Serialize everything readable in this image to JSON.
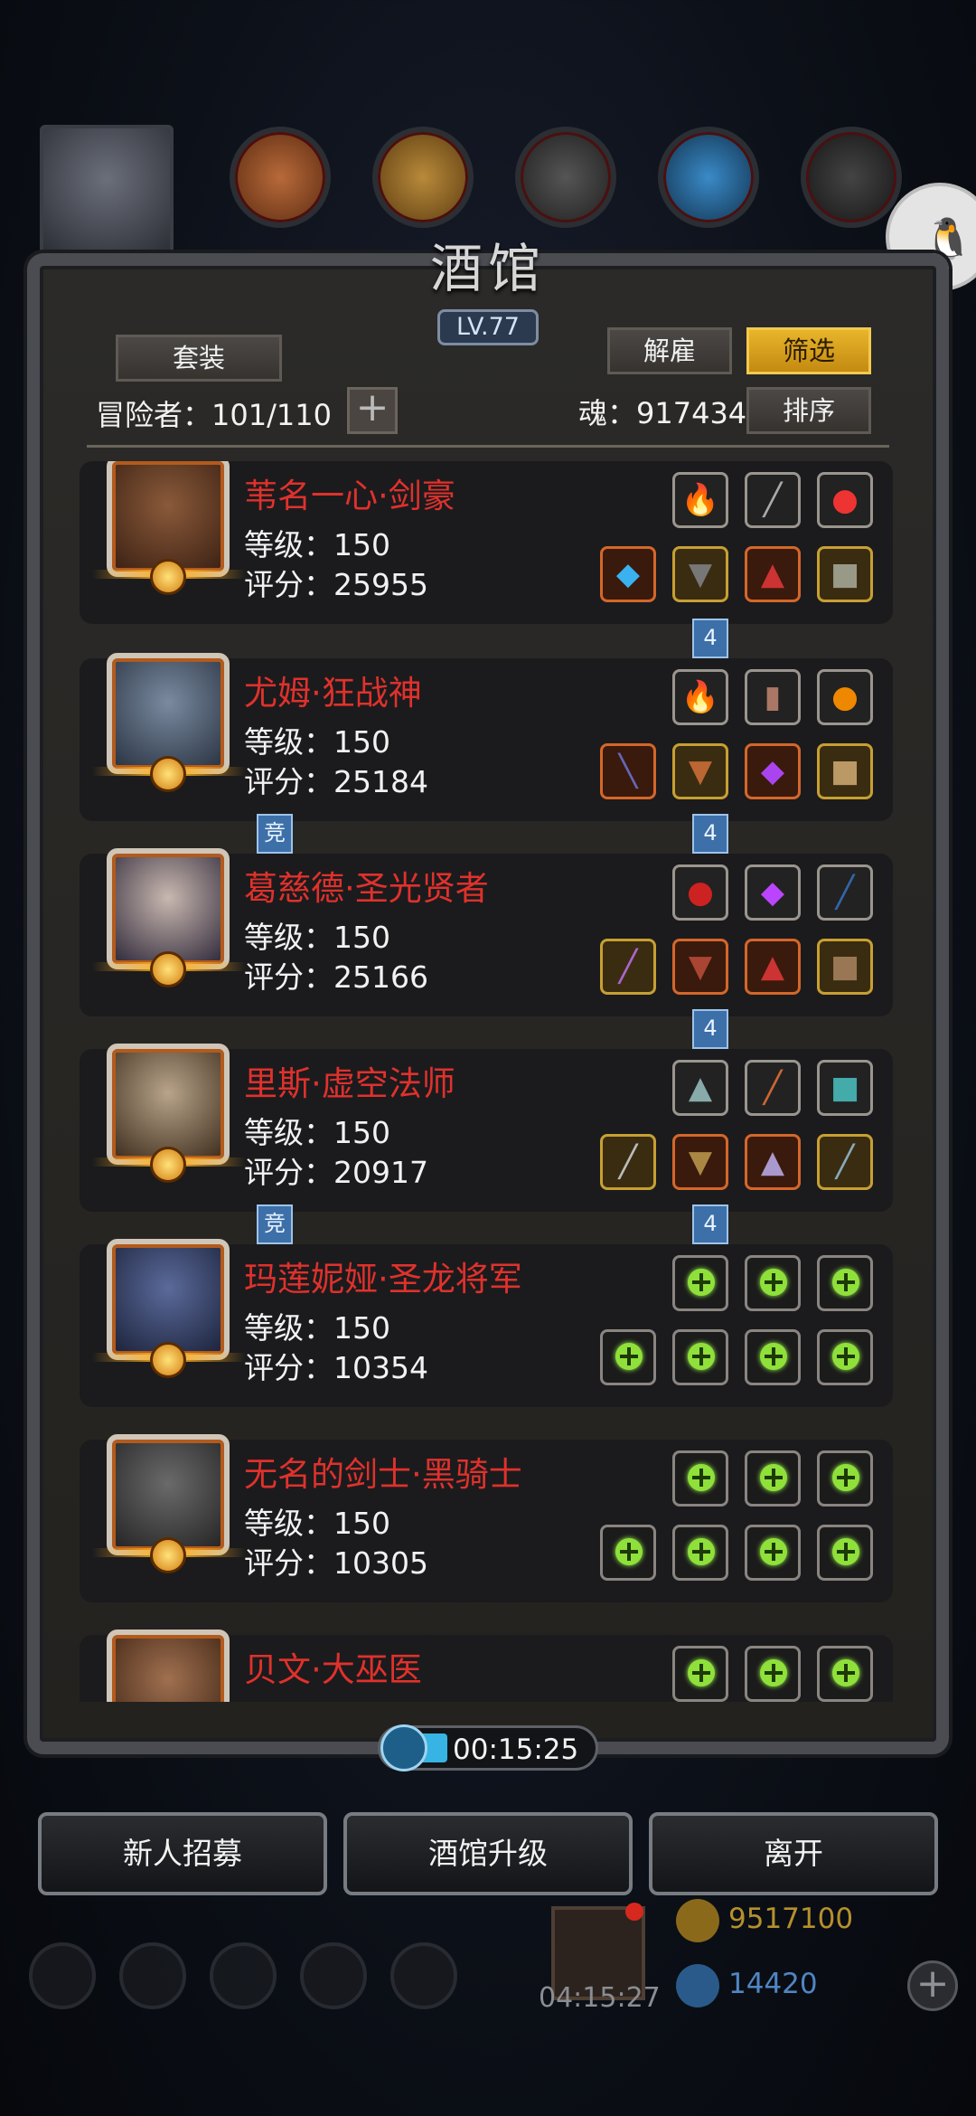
{
  "window": {
    "title": "酒馆",
    "level": "LV.77"
  },
  "controls": {
    "suit_label": "套装",
    "dismiss_label": "解雇",
    "filter_label": "筛选",
    "sort_label": "排序",
    "adventurers_label": "冒险者：101/110",
    "soul_label": "魂：917434",
    "plus": "+"
  },
  "heroes": [
    {
      "name": "苇名一心·剑豪",
      "level": "等级：150",
      "score": "评分：25955",
      "equipped": true,
      "tags": [
        "4"
      ]
    },
    {
      "name": "尤姆·狂战神",
      "level": "等级：150",
      "score": "评分：25184",
      "equipped": true,
      "tags": [
        "竞",
        "4"
      ]
    },
    {
      "name": "葛慈德·圣光贤者",
      "level": "等级：150",
      "score": "评分：25166",
      "equipped": true,
      "tags": [
        "4"
      ]
    },
    {
      "name": "里斯·虚空法师",
      "level": "等级：150",
      "score": "评分：20917",
      "equipped": true,
      "tags": [
        "竞",
        "4"
      ]
    },
    {
      "name": "玛莲妮娅·圣龙将军",
      "level": "等级：150",
      "score": "评分：10354",
      "equipped": false,
      "tags": []
    },
    {
      "name": "无名的剑士·黑骑士",
      "level": "等级：150",
      "score": "评分：10305",
      "equipped": false,
      "tags": []
    },
    {
      "name": "贝文·大巫医",
      "level": "",
      "score": "",
      "equipped": false,
      "tags": []
    }
  ],
  "timer": {
    "value": "00:15:25",
    "progress": 0.18
  },
  "bottom_buttons": {
    "recruit_label": "新人招募",
    "upgrade_label": "酒馆升级",
    "leave_label": "离开"
  },
  "hud": {
    "gift_timer": "04:15:27",
    "gold": "9517100",
    "gems": "14420",
    "plus": "+"
  },
  "colors": {
    "hero_name": "#e0312c",
    "filter_active": "#e8b52a",
    "tag_blue": "#3d6fa8",
    "empty_slot_plus": "#8fe03a"
  },
  "icons": {
    "timer": "clock-icon",
    "gold": "gold-coin-icon",
    "gem": "gem-icon",
    "gift": "gift-box-icon",
    "qq": "qq-penguin-icon"
  }
}
